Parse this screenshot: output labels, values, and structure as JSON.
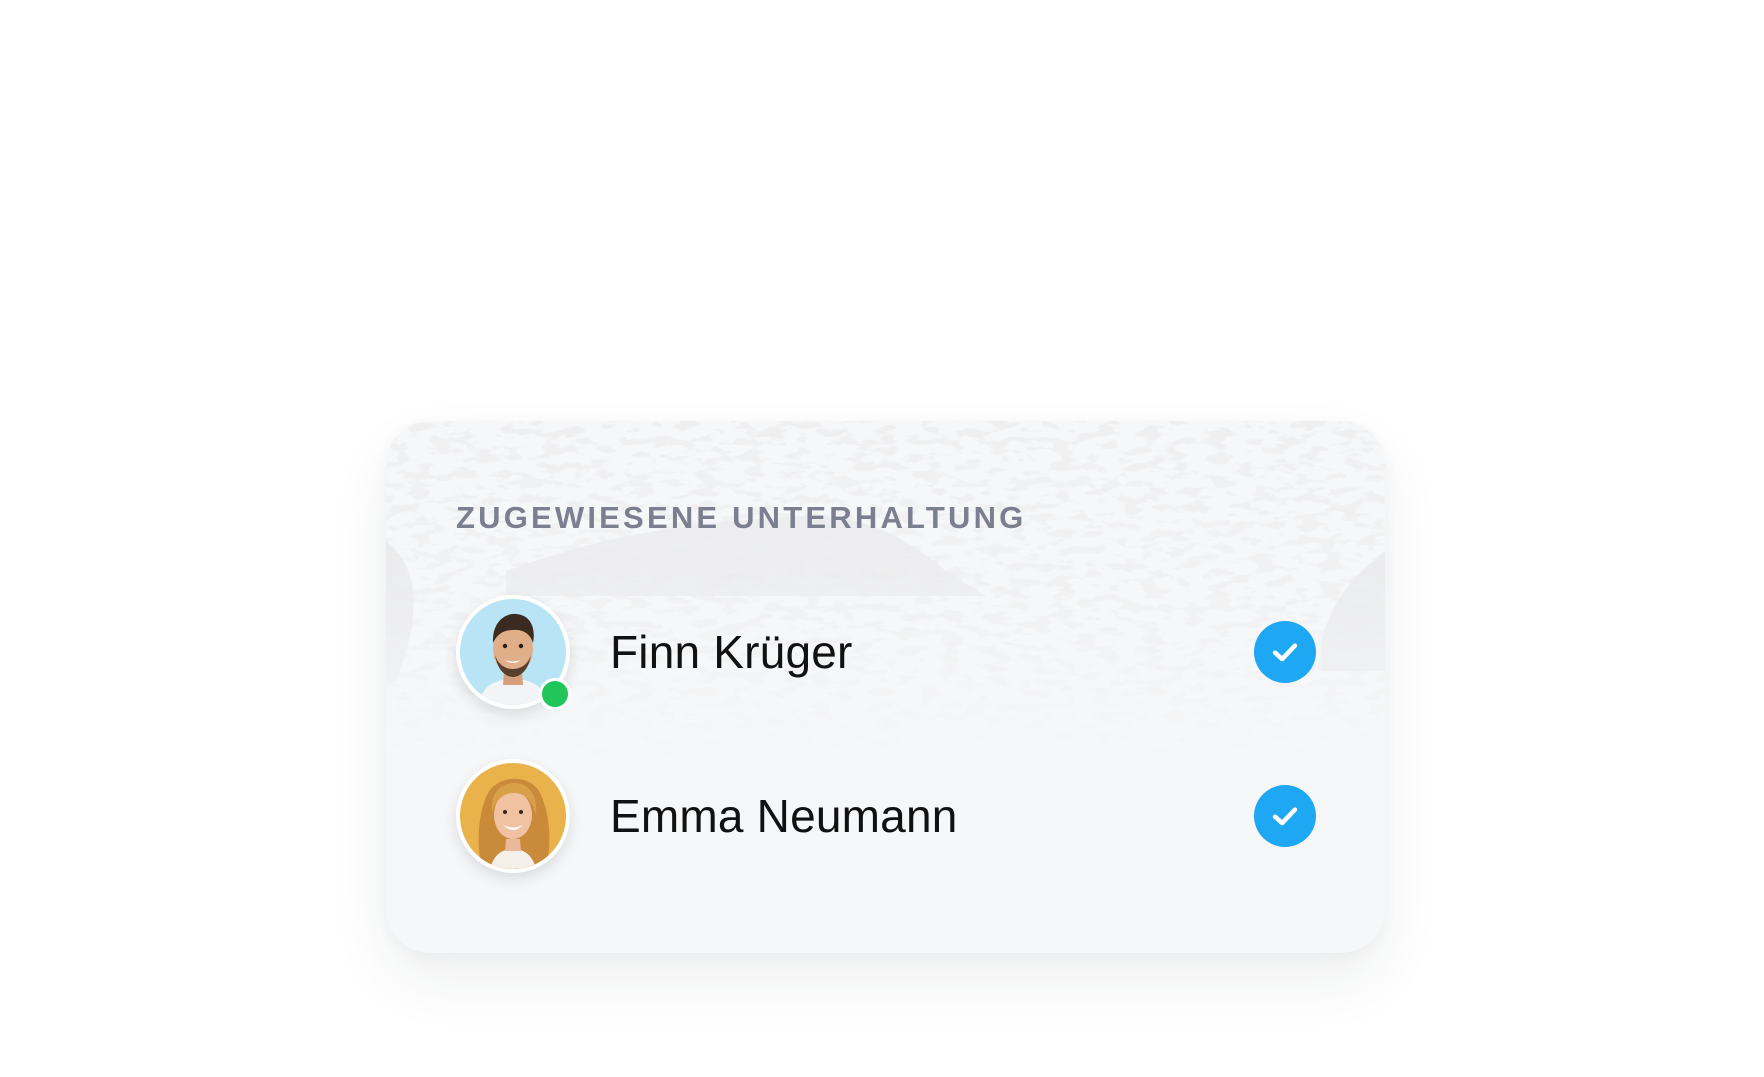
{
  "card": {
    "title": "ZUGEWIESENE UNTERHALTUNG"
  },
  "assignees": [
    {
      "name": "Finn Krüger",
      "online": true,
      "selected": true,
      "avatar_icon": "man-portrait-avatar",
      "avatar_bg": "#b9e4f6"
    },
    {
      "name": "Emma Neumann",
      "online": false,
      "selected": true,
      "avatar_icon": "woman-portrait-avatar",
      "avatar_bg": "#e9b24a"
    }
  ],
  "colors": {
    "check": "#1ea8f3",
    "online": "#20c65a",
    "title": "#7c7f8f",
    "card_bg": "#f6f7f8"
  }
}
